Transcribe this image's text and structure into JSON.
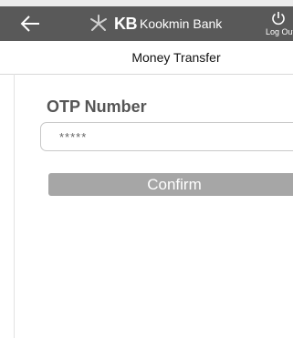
{
  "header": {
    "back_icon": "left-arrow-icon",
    "logo_mark_icon": "kb-star-logo-icon",
    "logo_kb": "KB",
    "logo_name": "Kookmin Bank",
    "logout_icon": "power-icon",
    "logout_label": "Log Out",
    "background": "#595959"
  },
  "page": {
    "title": "Money Transfer"
  },
  "otp": {
    "label": "OTP Number",
    "placeholder": "*****"
  },
  "actions": {
    "confirm_label": "Confirm",
    "confirm_color": "#a6a6a6"
  }
}
